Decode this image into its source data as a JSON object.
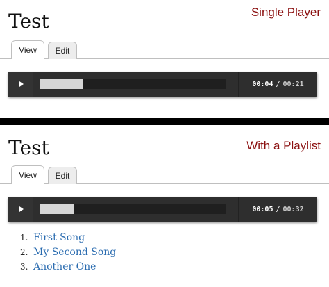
{
  "single": {
    "title": "Test",
    "caption": "Single Player",
    "tabs": [
      {
        "label": "View"
      },
      {
        "label": "Edit"
      }
    ],
    "player": {
      "current_time": "00:04",
      "total_time": "00:21",
      "separator": "/",
      "progress_fraction": 0.23
    }
  },
  "playlist_section": {
    "title": "Test",
    "caption": "With a Playlist",
    "tabs": [
      {
        "label": "View"
      },
      {
        "label": "Edit"
      }
    ],
    "player": {
      "current_time": "00:05",
      "total_time": "00:32",
      "separator": "/",
      "progress_fraction": 0.18
    },
    "items": [
      {
        "number": "1.",
        "label": "First Song"
      },
      {
        "number": "2.",
        "label": "My Second Song"
      },
      {
        "number": "3.",
        "label": "Another One"
      }
    ]
  },
  "colors": {
    "caption": "#8b1010",
    "link": "#2b6cb0",
    "player_bg": "#2e2e2e",
    "progress": "#d6d6d6"
  },
  "icons": {
    "play": "play-icon"
  }
}
